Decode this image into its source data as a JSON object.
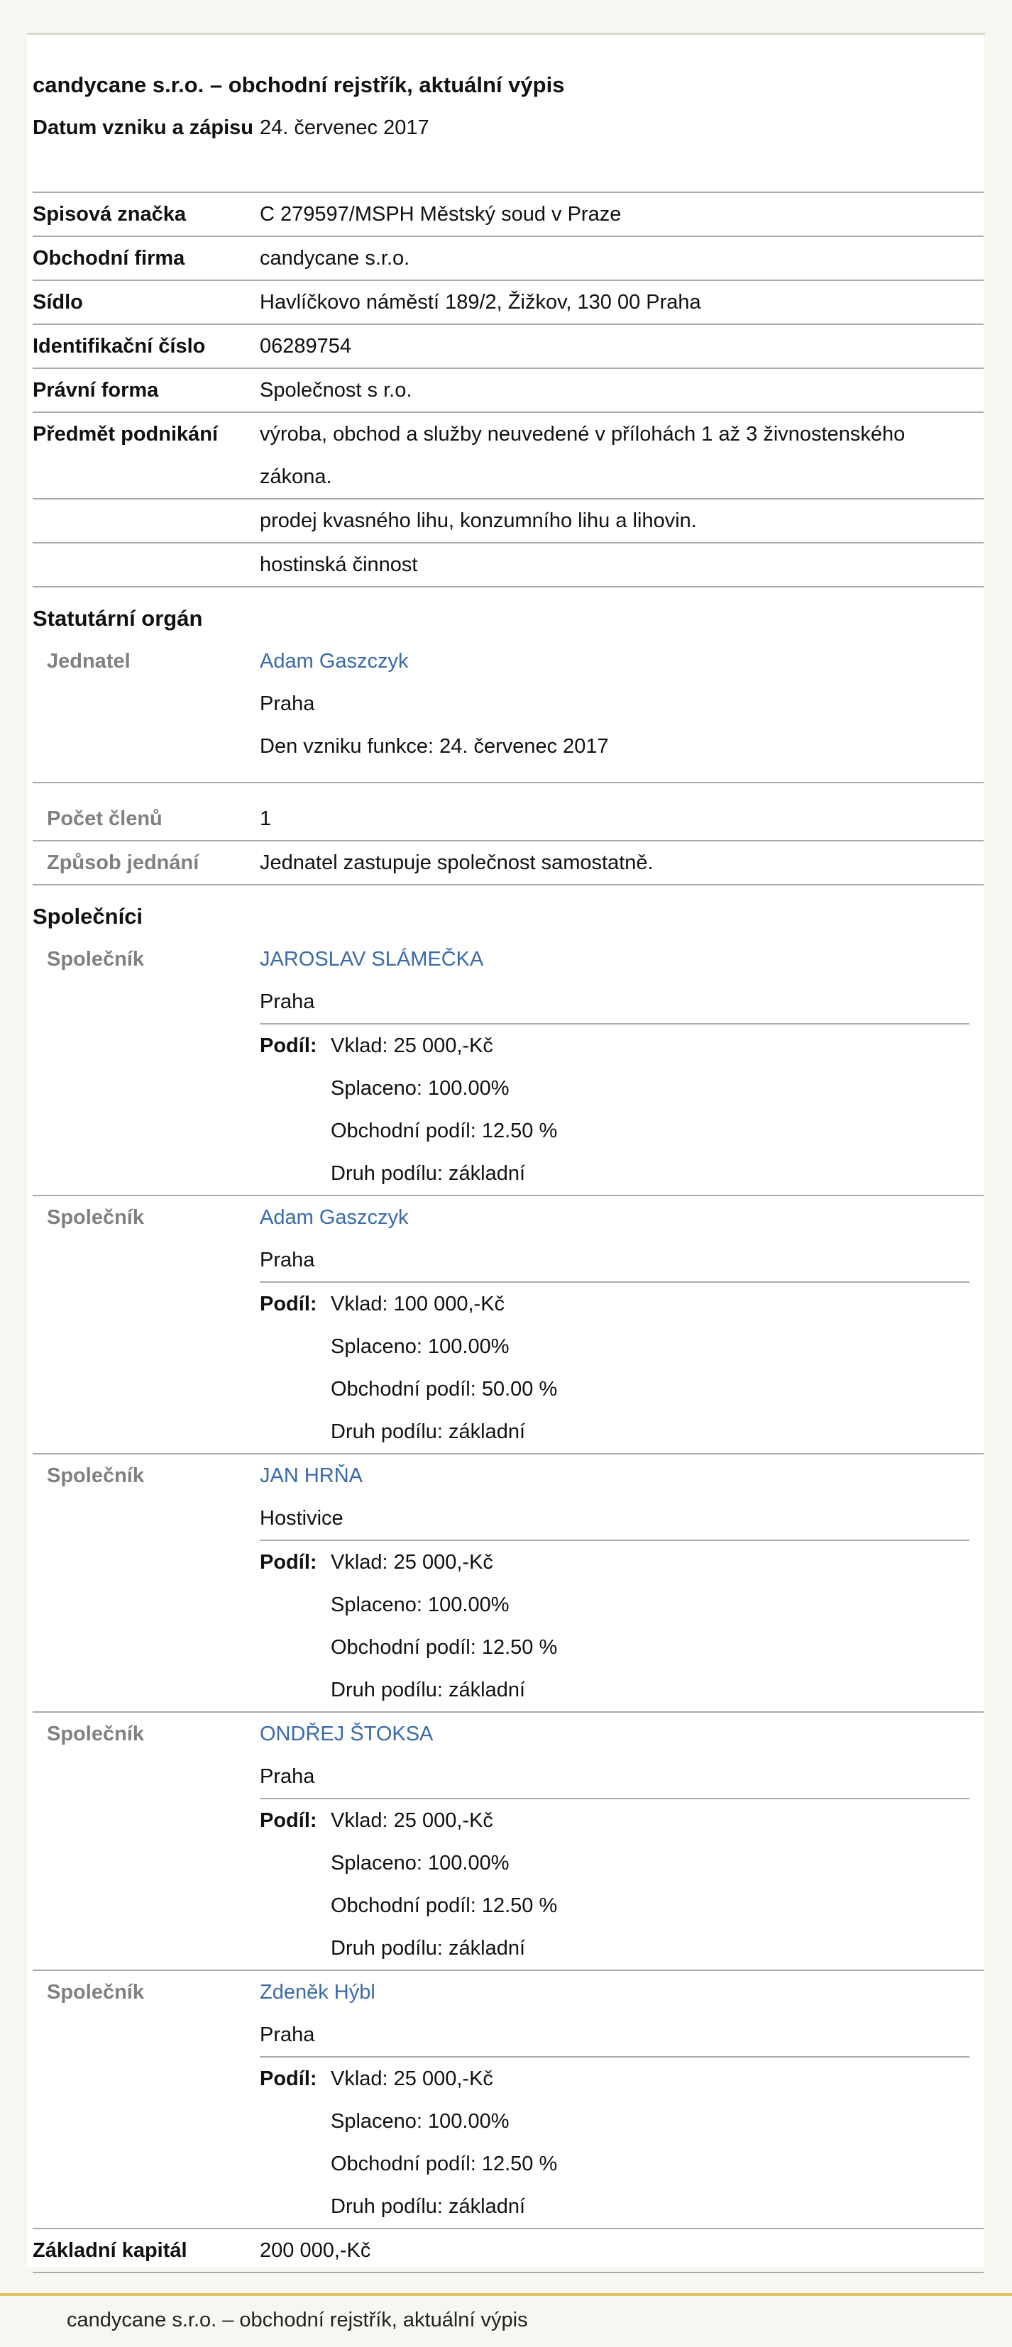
{
  "title": "candycane s.r.o. – obchodní rejstřík, aktuální výpis",
  "basic": [
    {
      "label": "Datum vzniku a zápisu",
      "values": [
        "24. červenec 2017"
      ]
    },
    {
      "label": "Spisová značka",
      "values": [
        "C 279597/MSPH Městský soud v Praze"
      ]
    },
    {
      "label": "Obchodní firma",
      "values": [
        "candycane s.r.o."
      ]
    },
    {
      "label": "Sídlo",
      "values": [
        "Havlíčkovo náměstí 189/2, Žižkov, 130 00 Praha"
      ]
    },
    {
      "label": "Identifikační číslo",
      "values": [
        "06289754"
      ]
    },
    {
      "label": "Právní forma",
      "values": [
        "Společnost s r.o."
      ]
    }
  ],
  "predmet": {
    "label": "Předmět podnikání",
    "items": [
      "výroba, obchod a služby neuvedené v přílohách 1 až 3 živnostenského zákona.",
      "prodej kvasného lihu, konzumního lihu a lihovin.",
      "hostinská činnost"
    ]
  },
  "statutarni": {
    "heading": "Statutární orgán",
    "jednatel_label": "Jednatel",
    "jednatel_name": "Adam Gaszczyk",
    "jednatel_city": "Praha",
    "jednatel_since": "Den vzniku funkce: 24. červenec 2017",
    "pocet_label": "Počet členů",
    "pocet_value": "1",
    "zpusob_label": "Způsob jednání",
    "zpusob_value": "Jednatel zastupuje společnost samostatně."
  },
  "spolecnici": {
    "heading": "Společníci",
    "item_label": "Společník",
    "podil_label": "Podíl:",
    "items": [
      {
        "name": "JAROSLAV SLÁMEČKA",
        "city": "Praha",
        "vklad": "Vklad: 25 000,-Kč",
        "splaceno": "Splaceno: 100.00%",
        "obchodni": "Obchodní podíl: 12.50 %",
        "druh": "Druh podílu: základní"
      },
      {
        "name": "Adam Gaszczyk",
        "city": "Praha",
        "vklad": "Vklad: 100 000,-Kč",
        "splaceno": "Splaceno: 100.00%",
        "obchodni": "Obchodní podíl: 50.00 %",
        "druh": "Druh podílu: základní"
      },
      {
        "name": "JAN HRŇA",
        "city": "Hostivice",
        "vklad": "Vklad: 25 000,-Kč",
        "splaceno": "Splaceno: 100.00%",
        "obchodni": "Obchodní podíl: 12.50 %",
        "druh": "Druh podílu: základní"
      },
      {
        "name": "ONDŘEJ ŠTOKSA",
        "city": "Praha",
        "vklad": "Vklad: 25 000,-Kč",
        "splaceno": "Splaceno: 100.00%",
        "obchodni": "Obchodní podíl: 12.50 %",
        "druh": "Druh podílu: základní"
      },
      {
        "name": "Zdeněk Hýbl",
        "city": "Praha",
        "vklad": "Vklad: 25 000,-Kč",
        "splaceno": "Splaceno: 100.00%",
        "obchodni": "Obchodní podíl: 12.50 %",
        "druh": "Druh podílu: základní"
      }
    ]
  },
  "kapital": {
    "label": "Základní kapitál",
    "value": "200 000,-Kč"
  },
  "footer": "candycane s.r.o. – obchodní rejstřík, aktuální výpis"
}
